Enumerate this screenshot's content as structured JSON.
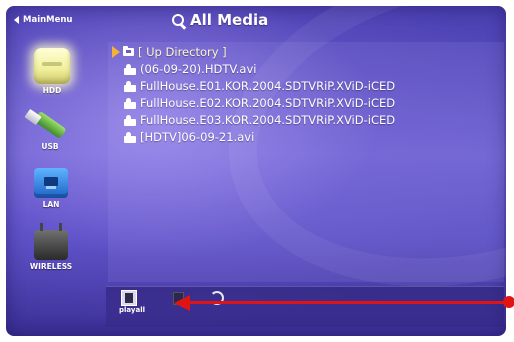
{
  "top": {
    "main_menu_label": "MainMenu",
    "title": "All Media"
  },
  "devices": [
    {
      "label": "HDD",
      "icon": "hdd-icon"
    },
    {
      "label": "USB",
      "icon": "usb-icon"
    },
    {
      "label": "LAN",
      "icon": "lan-icon"
    },
    {
      "label": "WIRELESS",
      "icon": "wireless-icon"
    }
  ],
  "files": [
    {
      "name": "[ Up Directory ]",
      "icon": "folder-icon"
    },
    {
      "name": "(06-09-20).HDTV.avi",
      "icon": "video-file-icon"
    },
    {
      "name": "FullHouse.E01.KOR.2004.SDTVRiP.XViD-iCED",
      "icon": "video-file-icon"
    },
    {
      "name": "FullHouse.E02.KOR.2004.SDTVRiP.XViD-iCED",
      "icon": "video-file-icon"
    },
    {
      "name": "FullHouse.E03.KOR.2004.SDTVRiP.XViD-iCED",
      "icon": "video-file-icon"
    },
    {
      "name": "[HDTV]06-09-21.avi",
      "icon": "video-file-icon"
    }
  ],
  "toolbar": {
    "playall_label": "playall"
  },
  "colors": {
    "background_top": "#4a3fb0",
    "background_mid": "#6b5fd0",
    "selection_pointer": "#f7b13a",
    "annotation_arrow": "#e11414"
  }
}
